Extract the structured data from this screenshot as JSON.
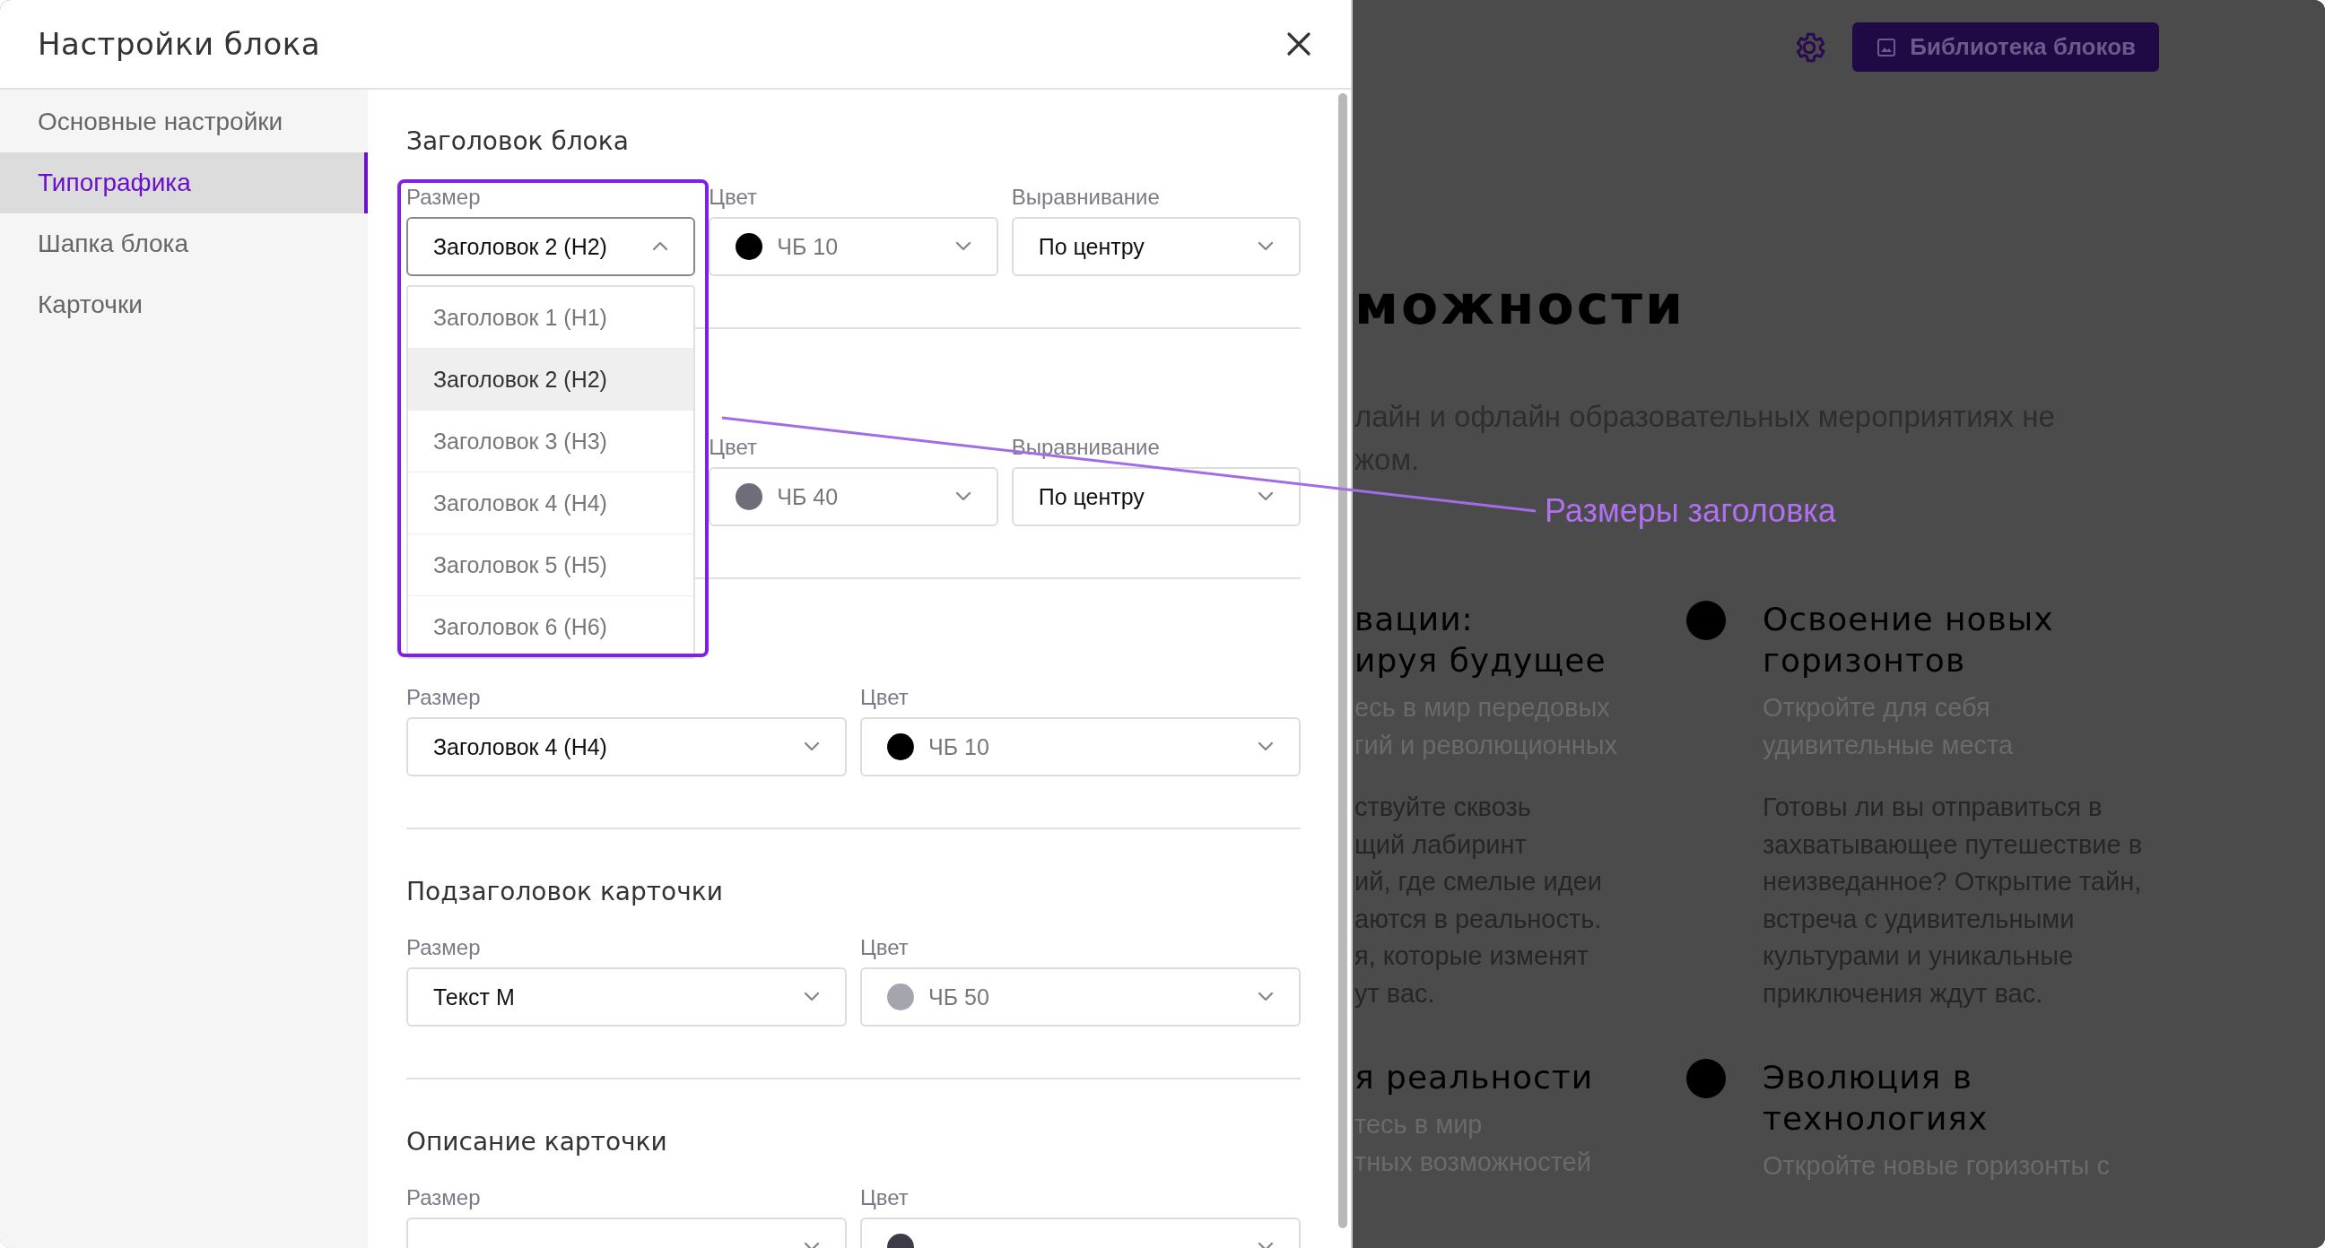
{
  "modal": {
    "title": "Настройки блока",
    "sidebar": [
      {
        "label": "Основные настройки",
        "selected": false
      },
      {
        "label": "Типографика",
        "selected": true
      },
      {
        "label": "Шапка блока",
        "selected": false
      },
      {
        "label": "Карточки",
        "selected": false
      }
    ],
    "sections": [
      {
        "title": "Заголовок блока",
        "covered": false,
        "fields": [
          {
            "kind": "select",
            "label": "Размер",
            "value": "Заголовок 2 (H2)",
            "open": true
          },
          {
            "kind": "color",
            "label": "Цвет",
            "value": "ЧБ 10",
            "color": "#000000",
            "open": false
          },
          {
            "kind": "select",
            "label": "Выравнивание",
            "value": "По центру",
            "open": false
          }
        ]
      },
      {
        "covered": true,
        "fields": [
          {
            "kind": "color",
            "label": "Цвет",
            "value": "ЧБ 40",
            "color": "#6e6e7a",
            "open": false
          },
          {
            "kind": "select",
            "label": "Выравнивание",
            "value": "По центру",
            "open": false
          }
        ]
      },
      {
        "covered": false,
        "fields": [
          {
            "kind": "select",
            "label": "Размер",
            "value": "Заголовок 4 (H4)",
            "open": false
          },
          {
            "kind": "color",
            "label": "Цвет",
            "value": "ЧБ 10",
            "color": "#000000",
            "open": false
          }
        ]
      },
      {
        "title": "Подзаголовок карточки",
        "covered": false,
        "fields": [
          {
            "kind": "select",
            "label": "Размер",
            "value": "Текст M",
            "open": false
          },
          {
            "kind": "color",
            "label": "Цвет",
            "value": "ЧБ 50",
            "color": "#a5a5ae",
            "open": false
          }
        ]
      },
      {
        "title": "Описание карточки",
        "covered": false,
        "fields": [
          {
            "kind": "select",
            "label": "Размер",
            "open": false
          },
          {
            "kind": "color",
            "label": "Цвет",
            "color": "#3c3c4a",
            "open": false
          }
        ]
      }
    ],
    "dropdown": {
      "options": [
        {
          "label": "Заголовок 1 (H1)",
          "selected": false
        },
        {
          "label": "Заголовок 2 (H2)",
          "selected": true
        },
        {
          "label": "Заголовок 3 (H3)",
          "selected": false
        },
        {
          "label": "Заголовок 4 (H4)",
          "selected": false
        },
        {
          "label": "Заголовок 5 (H5)",
          "selected": false
        },
        {
          "label": "Заголовок 6 (H6)",
          "selected": false
        }
      ]
    }
  },
  "callout": {
    "text": "Размеры заголовка"
  },
  "page": {
    "library_button": "Библиотека блоков",
    "heading": "можности",
    "intro_lines": [
      "лайн и офлайн образовательных мероприятиях не",
      "жом."
    ],
    "cards": [
      {
        "marker": false,
        "title_lines": [
          "вации:",
          "ируя будущее"
        ],
        "description_lines": [
          "есь в мир передовых",
          "гий и революционных"
        ],
        "body_lines": [
          "ствуйте сквозь",
          "щий лабиринт",
          "ий, где смелые идеи",
          "аются в реальность.",
          "я, которые изменят",
          "ут вас."
        ]
      },
      {
        "marker": true,
        "title_lines": [
          "Освоение новых",
          "горизонтов"
        ],
        "description_lines": [
          "Откройте для себя",
          "удивительные места"
        ],
        "body_lines": [
          "Готовы ли вы отправиться в",
          "захватывающее путешествие в",
          "неизведанное? Открытие тайн,",
          "встреча с удивительными",
          "культурами и уникальные",
          "приключения ждут вас."
        ]
      },
      {
        "marker": false,
        "title_lines": [
          "я реальности"
        ],
        "description_lines": [
          "тесь в мир",
          "тных возможностей"
        ]
      },
      {
        "marker": true,
        "title_lines": [
          "Эволюция в",
          "технологиях"
        ],
        "description_lines": [
          "Откройте новые горизонты с"
        ]
      }
    ]
  }
}
